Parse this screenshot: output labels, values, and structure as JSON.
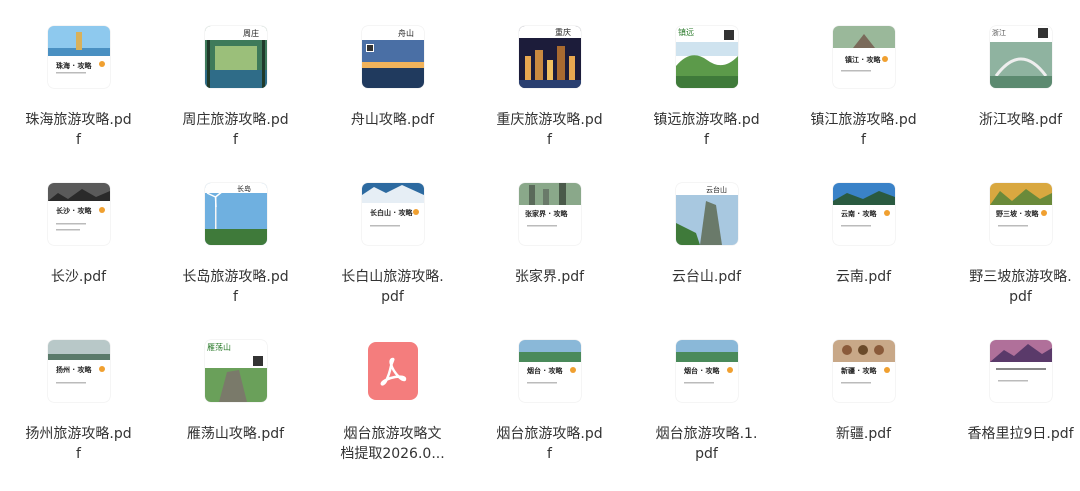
{
  "files": [
    {
      "name": "珠海旅游攻略.pdf",
      "cover_title": "珠海 · 攻略",
      "theme": "sea-tower"
    },
    {
      "name": "周庄旅游攻略.pdf",
      "cover_title": "周庄",
      "theme": "water-town"
    },
    {
      "name": "舟山攻略.pdf",
      "cover_title": "舟山",
      "theme": "night-sea"
    },
    {
      "name": "重庆旅游攻略.pdf",
      "cover_title": "重庆",
      "theme": "city-night"
    },
    {
      "name": "镇远旅游攻略.pdf",
      "cover_title": "镇远",
      "theme": "green-valley"
    },
    {
      "name": "镇江旅游攻略.pdf",
      "cover_title": "镇江 · 攻略",
      "theme": "temple"
    },
    {
      "name": "浙江攻略.pdf",
      "cover_title": "浙江",
      "theme": "bridge"
    },
    {
      "name": "长沙.pdf",
      "cover_title": "长沙 · 攻略",
      "theme": "sketch"
    },
    {
      "name": "长岛旅游攻略.pdf",
      "cover_title": "长岛",
      "theme": "windmill"
    },
    {
      "name": "长白山旅游攻略.pdf",
      "cover_title": "长白山 · 攻略",
      "theme": "lake"
    },
    {
      "name": "张家界.pdf",
      "cover_title": "张家界 · 攻略",
      "theme": "peaks"
    },
    {
      "name": "云台山.pdf",
      "cover_title": "云台山",
      "theme": "cliff"
    },
    {
      "name": "云南.pdf",
      "cover_title": "云南 · 攻略",
      "theme": "blue-lake"
    },
    {
      "name": "野三坡旅游攻略.pdf",
      "cover_title": "野三坡 · 攻略",
      "theme": "autumn"
    },
    {
      "name": "扬州旅游攻略.pdf",
      "cover_title": "扬州 · 攻略",
      "theme": "river"
    },
    {
      "name": "雁荡山攻略.pdf",
      "cover_title": "雁荡山",
      "theme": "mountain"
    },
    {
      "name": "烟台旅游攻略文档提取2026.0...",
      "cover_title": "",
      "theme": "pdf-app"
    },
    {
      "name": "烟台旅游攻略.pdf",
      "cover_title": "烟台 · 攻略",
      "theme": "coast"
    },
    {
      "name": "烟台旅游攻略.1.pdf",
      "cover_title": "烟台 · 攻略",
      "theme": "coast"
    },
    {
      "name": "新疆.pdf",
      "cover_title": "新疆 · 攻略",
      "theme": "people"
    },
    {
      "name": "香格里拉9日.pdf",
      "cover_title": "",
      "theme": "sunset"
    }
  ],
  "colors": {
    "background": "#ffffff",
    "label_text": "#333333",
    "pdf_app_bg": "#f47d7d"
  }
}
